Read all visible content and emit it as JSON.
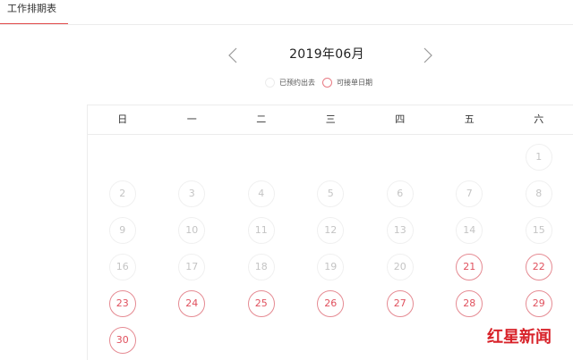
{
  "tabs": [
    {
      "label": "工作排期表",
      "active": true
    }
  ],
  "calendar": {
    "month_title": "2019年06月",
    "legend": {
      "booked_label": "已预约出去",
      "available_label": "可接单日期"
    },
    "weekdays": [
      "日",
      "一",
      "二",
      "三",
      "四",
      "五",
      "六"
    ],
    "days": [
      {
        "label": "1",
        "status": "past"
      },
      {
        "label": "2",
        "status": "past"
      },
      {
        "label": "3",
        "status": "past"
      },
      {
        "label": "4",
        "status": "past"
      },
      {
        "label": "5",
        "status": "past"
      },
      {
        "label": "6",
        "status": "past"
      },
      {
        "label": "7",
        "status": "past"
      },
      {
        "label": "8",
        "status": "past"
      },
      {
        "label": "9",
        "status": "past"
      },
      {
        "label": "10",
        "status": "past"
      },
      {
        "label": "11",
        "status": "past"
      },
      {
        "label": "12",
        "status": "past"
      },
      {
        "label": "13",
        "status": "past"
      },
      {
        "label": "14",
        "status": "past"
      },
      {
        "label": "15",
        "status": "past"
      },
      {
        "label": "16",
        "status": "past"
      },
      {
        "label": "17",
        "status": "past"
      },
      {
        "label": "18",
        "status": "past"
      },
      {
        "label": "19",
        "status": "past"
      },
      {
        "label": "20",
        "status": "past"
      },
      {
        "label": "21",
        "status": "available"
      },
      {
        "label": "22",
        "status": "available"
      },
      {
        "label": "23",
        "status": "available"
      },
      {
        "label": "24",
        "status": "available"
      },
      {
        "label": "25",
        "status": "available"
      },
      {
        "label": "26",
        "status": "available"
      },
      {
        "label": "27",
        "status": "available"
      },
      {
        "label": "28",
        "status": "available"
      },
      {
        "label": "29",
        "status": "available"
      },
      {
        "label": "30",
        "status": "available"
      }
    ]
  },
  "watermark": {
    "text": "红星新闻",
    "color": "#d8232a"
  },
  "colors": {
    "accent": "#e14a4a",
    "available_border": "#e58a92",
    "available_text": "#e0505d",
    "past_text": "#c4c4c4"
  },
  "icons": {
    "prev": "chevron-left-icon",
    "next": "chevron-right-icon"
  }
}
